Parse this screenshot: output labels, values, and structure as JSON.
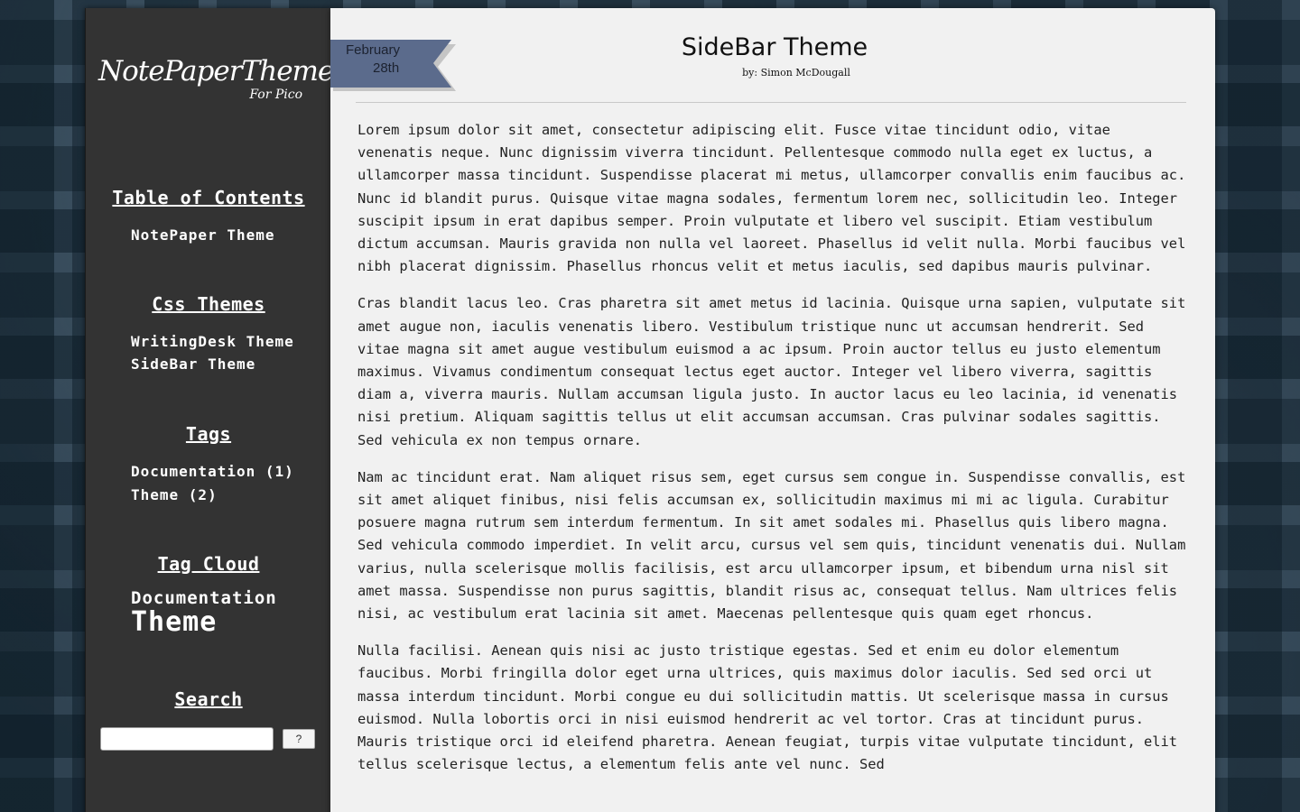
{
  "logo": {
    "main": "NotePaperTheme",
    "sub": "For Pico"
  },
  "sidebar": {
    "toc": {
      "heading": "Table of Contents",
      "items": [
        "NotePaper Theme"
      ]
    },
    "css_themes": {
      "heading": "Css Themes",
      "items": [
        "WritingDesk Theme",
        "SideBar Theme"
      ]
    },
    "tags": {
      "heading": "Tags",
      "items": [
        "Documentation (1)",
        "Theme (2)"
      ]
    },
    "tag_cloud": {
      "heading": "Tag Cloud",
      "items": [
        "Documentation",
        "Theme"
      ]
    },
    "search": {
      "heading": "Search",
      "placeholder": "",
      "value": "",
      "button_label": "?"
    }
  },
  "post": {
    "date_month": "February",
    "date_day": "28th",
    "title": "SideBar Theme",
    "author": "by: Simon McDougall",
    "paragraphs": [
      "Lorem ipsum dolor sit amet, consectetur adipiscing elit. Fusce vitae tincidunt odio, vitae venenatis neque. Nunc dignissim viverra tincidunt. Pellentesque commodo nulla eget ex luctus, a ullamcorper massa tincidunt. Suspendisse placerat mi metus, ullamcorper convallis enim faucibus ac. Nunc id blandit purus. Quisque vitae magna sodales, fermentum lorem nec, sollicitudin leo. Integer suscipit ipsum in erat dapibus semper. Proin vulputate et libero vel suscipit. Etiam vestibulum dictum accumsan. Mauris gravida non nulla vel laoreet. Phasellus id velit nulla. Morbi faucibus vel nibh placerat dignissim. Phasellus rhoncus velit et metus iaculis, sed dapibus mauris pulvinar.",
      "Cras blandit lacus leo. Cras pharetra sit amet metus id lacinia. Quisque urna sapien, vulputate sit amet augue non, iaculis venenatis libero. Vestibulum tristique nunc ut accumsan hendrerit. Sed vitae magna sit amet augue vestibulum euismod a ac ipsum. Proin auctor tellus eu justo elementum maximus. Vivamus condimentum consequat lectus eget auctor. Integer vel libero viverra, sagittis diam a, viverra mauris. Nullam accumsan ligula justo. In auctor lacus eu leo lacinia, id venenatis nisi pretium. Aliquam sagittis tellus ut elit accumsan accumsan. Cras pulvinar sodales sagittis. Sed vehicula ex non tempus ornare.",
      "Nam ac tincidunt erat. Nam aliquet risus sem, eget cursus sem congue in. Suspendisse convallis, est sit amet aliquet finibus, nisi felis accumsan ex, sollicitudin maximus mi mi ac ligula. Curabitur posuere magna rutrum sem interdum fermentum. In sit amet sodales mi. Phasellus quis libero magna. Sed vehicula commodo imperdiet. In velit arcu, cursus vel sem quis, tincidunt venenatis dui. Nullam varius, nulla scelerisque mollis facilisis, est arcu ullamcorper ipsum, et bibendum urna nisl sit amet massa. Suspendisse non purus sagittis, blandit risus ac, consequat tellus. Nam ultrices felis nisi, ac vestibulum erat lacinia sit amet. Maecenas pellentesque quis quam eget rhoncus.",
      "Nulla facilisi. Aenean quis nisi ac justo tristique egestas. Sed et enim eu dolor elementum faucibus. Morbi fringilla dolor eget urna ultrices, quis maximus dolor iaculis. Sed sed orci ut massa interdum tincidunt. Morbi congue eu dui sollicitudin mattis. Ut scelerisque massa in cursus euismod. Nulla lobortis orci in nisi euismod hendrerit ac vel tortor. Cras at tincidunt purus. Mauris tristique orci id eleifend pharetra. Aenean feugiat, turpis vitae vulputate tincidunt, elit tellus scelerisque lectus, a elementum felis ante vel nunc. Sed"
    ]
  },
  "colors": {
    "sidebar_bg": "#333333",
    "page_bg": "#f1f1f1",
    "ribbon": "#5b6b8c",
    "background": "#2f4251"
  }
}
